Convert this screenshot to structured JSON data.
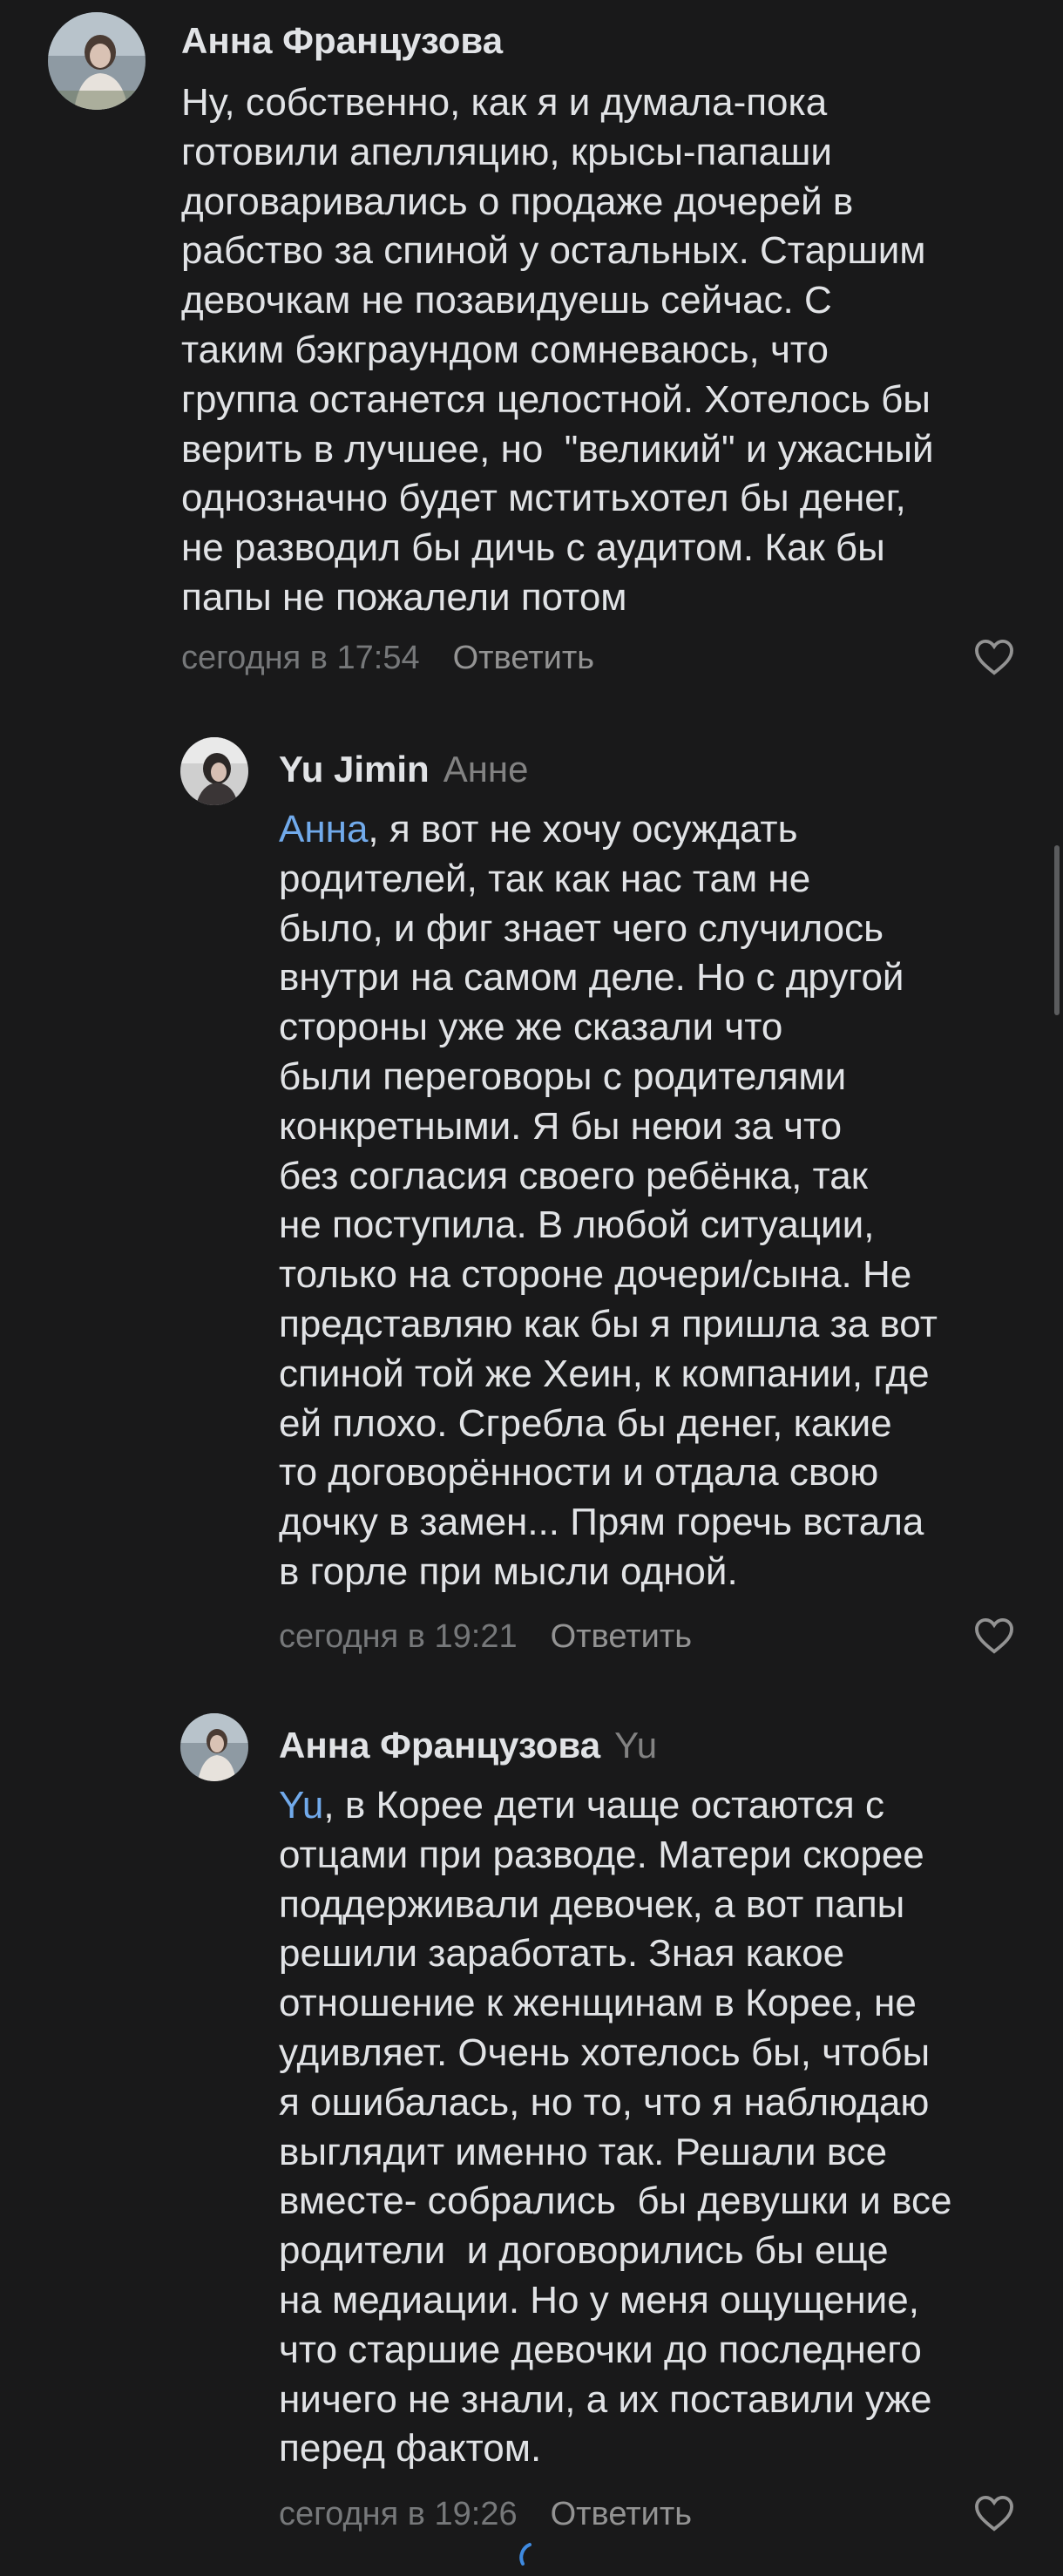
{
  "comments": [
    {
      "author": "Анна Французова",
      "reply_to": "",
      "mention": "",
      "text": "Ну, собственно, как я и думала-пока\nготовили апелляцию, крысы-папаши\nдоговаривались о продаже дочерей в\nрабство за спиной у остальных. Старшим\nдевочкам не позавидуешь сейчас. С\nтаким бэкграундом сомневаюсь, что\nгруппа останется целостной. Хотелось бы\nверить в лучшее, но  \"великий\" и ужасный\nоднозначно будет мститьхотел бы денег,\nне разводил бы дичь с аудитом. Как бы\nпапы не пожалели потом",
      "time": "сегодня в 17:54",
      "reply_label": "Ответить"
    },
    {
      "author": "Yu Jimin",
      "reply_to": "Анне",
      "mention": "Анна",
      "text": ", я вот не хочу осуждать\nродителей, так как нас там не\nбыло, и фиг знает чего случилось\nвнутри на самом деле. Но с другой\nстороны уже же сказали что\nбыли переговоры с родителями\nконкретными. Я бы неюи за что\nбез согласия своего ребёнка, так\nне поступила. В любой ситуации,\nтолько на стороне дочери/сына. Не\nпредставляю как бы я пришла за вот\nспиной той же Хеин, к компании, где\nей плохо. Сгребла бы денег, какие\nто договорённости и отдала свою\nдочку в замен... Прям горечь встала\nв горле при мысли одной.",
      "time": "сегодня в 19:21",
      "reply_label": "Ответить"
    },
    {
      "author": "Анна Французова",
      "reply_to": "Yu",
      "mention": "Yu",
      "text": ", в Корее дети чаще остаются с\nотцами при разводе. Матери скорее\nподдерживали девочек, а вот папы\nрешили заработать. Зная какое\nотношение к женщинам в Корее, не\nудивляет. Очень хотелось бы, чтобы\nя ошибалась, но то, что я наблюдаю\nвыглядит именно так. Решали все\nвместе- собрались  бы девушки и все\nродители  и договорились бы еще\nна медиации. Но у меня ощущение,\nчто старшие девочки до последнего\nничего не знали, а их поставили уже\nперед фактом.",
      "time": "сегодня в 19:26",
      "reply_label": "Ответить"
    }
  ],
  "icons": {
    "like": "heart-outline-icon",
    "avatar_anna": "avatar-photo",
    "avatar_yu": "avatar-photo",
    "loader": "loading-spinner-icon"
  },
  "colors": {
    "background": "#19191a",
    "text": "#e1e3e6",
    "mention": "#71aaeb",
    "muted": "#76787a"
  }
}
